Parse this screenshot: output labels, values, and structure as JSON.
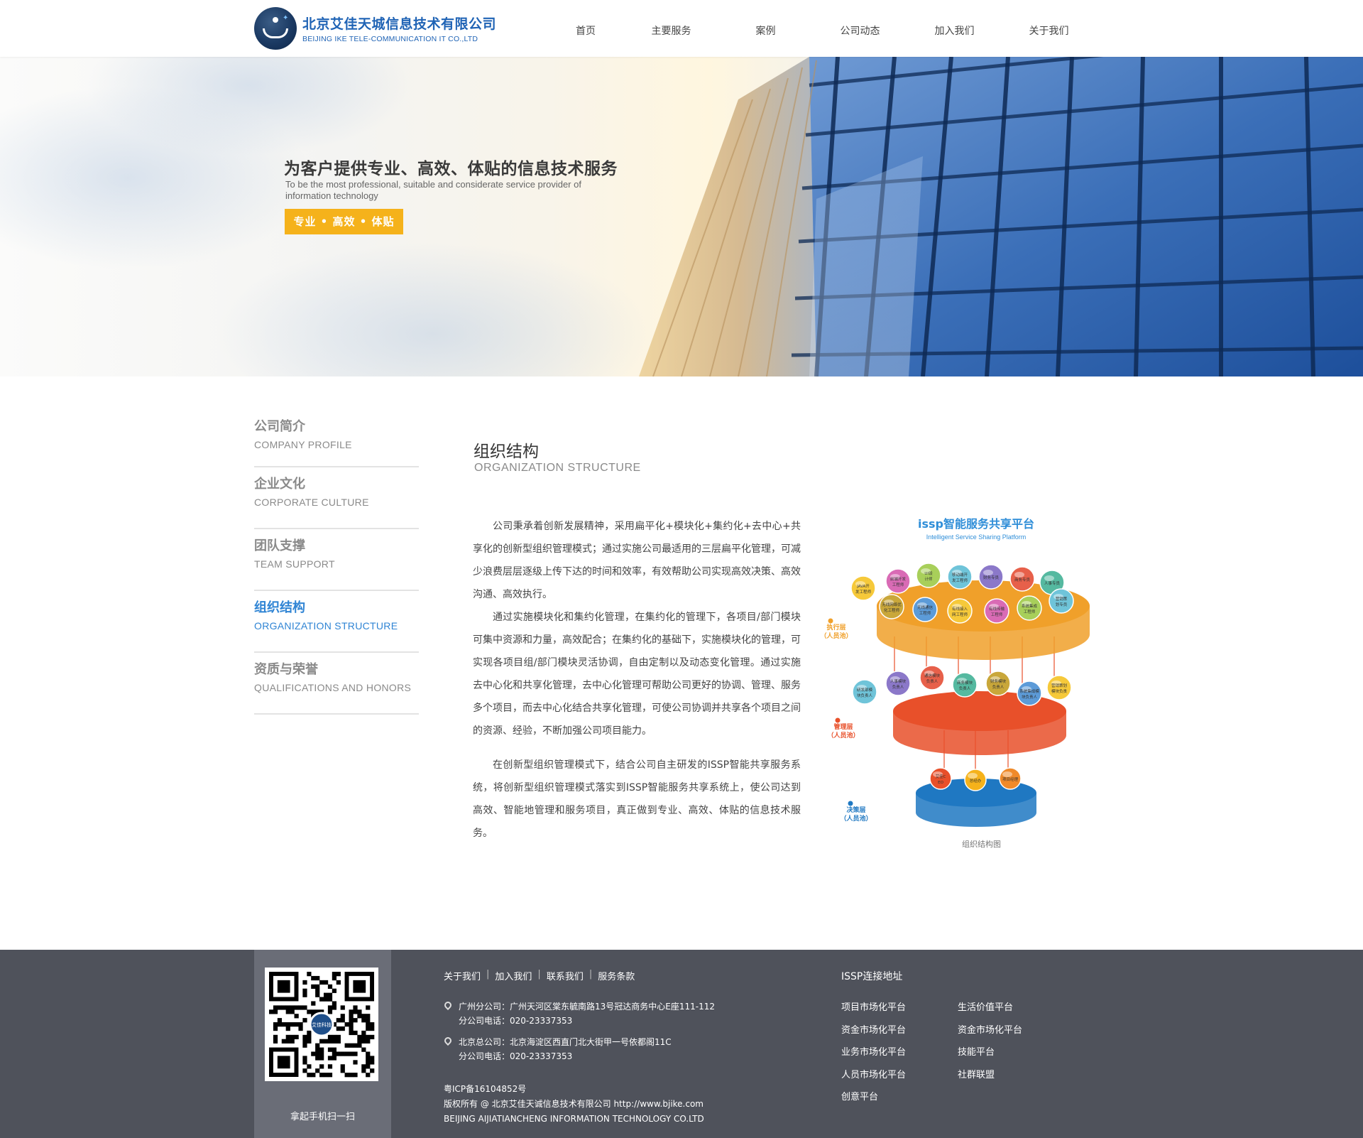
{
  "header": {
    "company_cn": "北京艾佳天城信息技术有限公司",
    "company_en": "BEIJING IKE TELE-COMMUNICATION IT CO.,LTD",
    "nav": [
      "首页",
      "主要服务",
      "案例",
      "公司动态",
      "加入我们",
      "关于我们"
    ]
  },
  "banner": {
    "title": "为客户提供专业、高效、体贴的信息技术服务",
    "subtitle": "To be the most professional, suitable and considerate service provider of information technology",
    "button": "专业 • 高效 • 体贴"
  },
  "sidebar": {
    "items": [
      {
        "cn": "公司简介",
        "en": "COMPANY PROFILE"
      },
      {
        "cn": "企业文化",
        "en": "CORPORATE CULTURE"
      },
      {
        "cn": "团队支撑",
        "en": "TEAM SUPPORT"
      },
      {
        "cn": "组织结构",
        "en": "ORGANIZATION STRUCTURE"
      },
      {
        "cn": "资质与荣誉",
        "en": "QUALIFICATIONS AND HONORS"
      }
    ],
    "active_index": 3
  },
  "content": {
    "title": "组织结构",
    "subtitle": "ORGANIZATION STRUCTURE",
    "paragraphs": [
      "公司秉承着创新发展精神，采用扁平化+模块化+集约化+去中心+共享化的创新型组织管理模式；通过实施公司最适用的三层扁平化管理，可减少浪费层层逐级上传下达的时间和效率，有效帮助公司实现高效决策、高效沟通、高效执行。",
      "通过实施模块化和集约化管理，在集约化的管理下，各项目/部门模块可集中资源和力量，高效配合；在集约化的基础下，实施模块化的管理，可实现各项目组/部门模块灵活协调，自由定制以及动态变化管理。通过实施去中心化和共享化管理，去中心化管理可帮助公司更好的协调、管理、服务多个项目，而去中心化结合共享化管理，可使公司协调并共享各个项目之间的资源、经验，不断加强公司项目能力。",
      "在创新型组织管理模式下，结合公司自主研发的ISSP智能共享服务系统，将创新型组织管理模式落实到ISSP智能服务共享系统上，使公司达到高效、智能地管理和服务项目，真正做到专业、高效、体贴的信息技术服务。"
    ],
    "diagram": {
      "title": "issp智能服务共享平台",
      "subtitle": "Intelligent Service Sharing Platform",
      "caption": "组织结构图",
      "layers": [
        {
          "label": "执行层",
          "sub": "（人员池）",
          "color": "#f0a02a",
          "nodes": [
            "JAVA开发工程师",
            "前端开发工程师",
            "UI设计师",
            "移动端开发工程师",
            "财务专员",
            "商务专员",
            "人事专员",
            "无线网络优化工程师",
            "无线通信工程师",
            "有线接入网工程师",
            "有线传输工程师",
            "系统集成工程师",
            "营销策划专员"
          ]
        },
        {
          "label": "管理层",
          "sub": "（人员池）",
          "color": "#e8502a",
          "nodes": [
            "研发部模块负责人",
            "人事模块负责人",
            "通信模块负责人",
            "商务模块负责人",
            "财务模块负责人",
            "系统集成模块负责人",
            "营销策划模块负责"
          ]
        },
        {
          "label": "决策层",
          "sub": "（人员池）",
          "color": "#1f78c2",
          "nodes": [
            "艾佳CEO",
            "总经办",
            "项目经理"
          ]
        }
      ]
    }
  },
  "footer": {
    "qr_label": "拿起手机扫一扫",
    "qr_center": "艾佳科技",
    "links": [
      "关于我们",
      "加入我们",
      "联系我们",
      "服务条款"
    ],
    "addresses": [
      {
        "line1": "广州分公司：广州天河区棠东毓南路13号冠达商务中心E座111-112",
        "line2": "分公司电话：020-23337353"
      },
      {
        "line1": "北京总公司：北京海淀区西直门北大街甲一号依都阁11C",
        "line2": "分公司电话：020-23337353"
      }
    ],
    "icp": "粤ICP备16104852号",
    "copyright": "版权所有 @ 北京艾佳天诚信息技术有限公司 http://www.bjike.com",
    "company_en": "BEIJING AIJIATIANCHENG INFORMATION TECHNOLOGY CO.LTD",
    "issp_title": "ISSP连接地址",
    "issp_col1": [
      "项目市场化平台",
      "资金市场化平台",
      "业务市场化平台",
      "人员市场化平台",
      "创意平台"
    ],
    "issp_col2": [
      "生活价值平台",
      "资金市场化平台",
      "技能平台",
      "社群联盟"
    ]
  }
}
